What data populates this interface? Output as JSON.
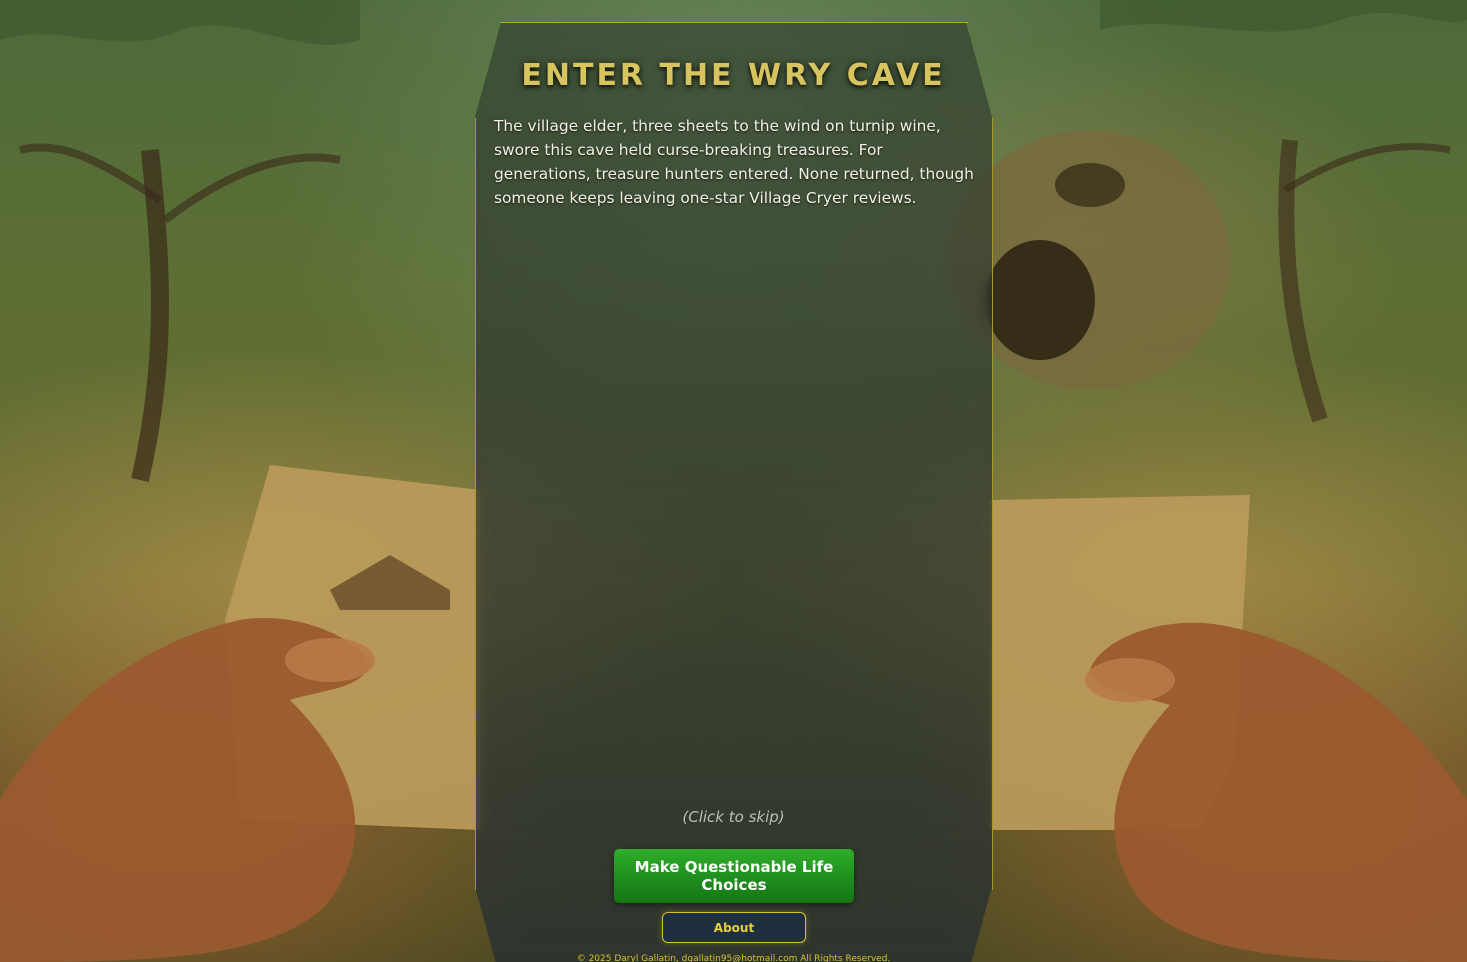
{
  "intro": {
    "title": "ENTER THE WRY CAVE",
    "story": "The village elder, three sheets to the wind on turnip wine, swore this cave held curse-breaking treasures. For generations, treasure hunters entered. None returned, though someone keeps leaving one-star Village Cryer reviews.",
    "skip_hint": "(Click to skip)"
  },
  "actions": {
    "start_label": "Make Questionable Life Choices",
    "about_label": "About"
  },
  "footer": {
    "copyright": "© 2025 Daryl Gallatin, dgallatin95@hotmail.com All Rights Reserved."
  },
  "colors": {
    "accent_gold": "#d8c45e",
    "start_green": "#1d8b1e",
    "about_bg": "#1e2f40"
  }
}
